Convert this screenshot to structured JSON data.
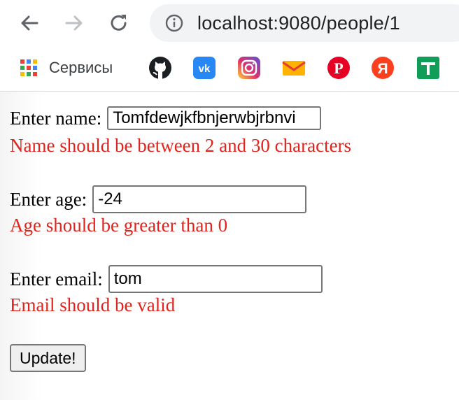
{
  "browser": {
    "url": "localhost:9080/people/1",
    "bookmarks": [
      {
        "label": "Сервисы",
        "icon": "apps-grid-icon"
      },
      {
        "label": "",
        "icon": "github-icon"
      },
      {
        "label": "",
        "icon": "vk-icon",
        "glyph": "vk",
        "color": "#2787f5"
      },
      {
        "label": "",
        "icon": "instagram-icon"
      },
      {
        "label": "",
        "icon": "mail-icon"
      },
      {
        "label": "",
        "icon": "pinterest-icon",
        "glyph": "P",
        "color": "#e60023"
      },
      {
        "label": "",
        "icon": "yandex-icon",
        "glyph": "Я",
        "color": "#fc3f1d"
      },
      {
        "label": "",
        "icon": "google-plus-icon",
        "color": "#0f9d58"
      }
    ]
  },
  "form": {
    "name_label": "Enter name:",
    "name_value": "Tomfdewjkfbnjerwbjrbnvi",
    "name_error": "Name should be between 2 and 30 characters",
    "age_label": "Enter age:",
    "age_value": "-24",
    "age_error": "Age should be greater than 0",
    "email_label": "Enter email:",
    "email_value": "tom",
    "email_error": "Email should be valid",
    "submit_label": "Update!"
  },
  "colors": {
    "error": "#e0231c",
    "omnibox": "#f1f3f4"
  }
}
